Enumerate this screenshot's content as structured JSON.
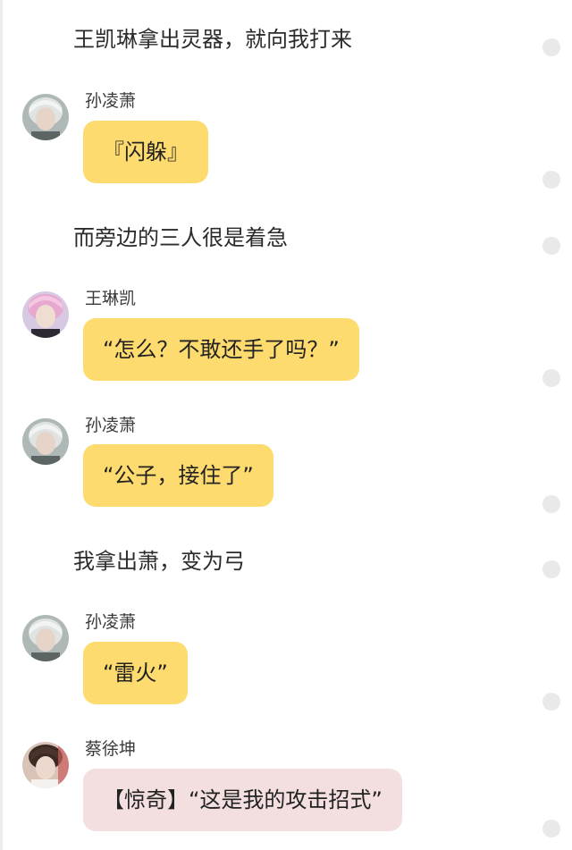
{
  "messages": [
    {
      "type": "narration",
      "text": "王凯琳拿出灵器，就向我打来"
    },
    {
      "type": "speech",
      "speaker": "孙凌萧",
      "text": "『闪躲』",
      "avatar": "avatar-silver-hair"
    },
    {
      "type": "narration",
      "text": "而旁边的三人很是着急"
    },
    {
      "type": "speech",
      "speaker": "王琳凯",
      "text": "“怎么？不敢还手了吗？”",
      "avatar": "avatar-pink-hair"
    },
    {
      "type": "speech",
      "speaker": "孙凌萧",
      "text": "“公子，接住了”",
      "avatar": "avatar-silver-hair"
    },
    {
      "type": "narration",
      "text": "我拿出萧，变为弓"
    },
    {
      "type": "speech",
      "speaker": "孙凌萧",
      "text": "“雷火”",
      "avatar": "avatar-silver-hair"
    },
    {
      "type": "speech",
      "speaker": "蔡徐坤",
      "text": "【惊奇】“这是我的攻击招式”",
      "avatar": "avatar-dark-hair"
    }
  ],
  "colors": {
    "bubble_yellow": "#fedb6e",
    "bubble_pink": "#f3dfe0",
    "dot": "#e9e9e9",
    "text": "#2b2b2b"
  }
}
